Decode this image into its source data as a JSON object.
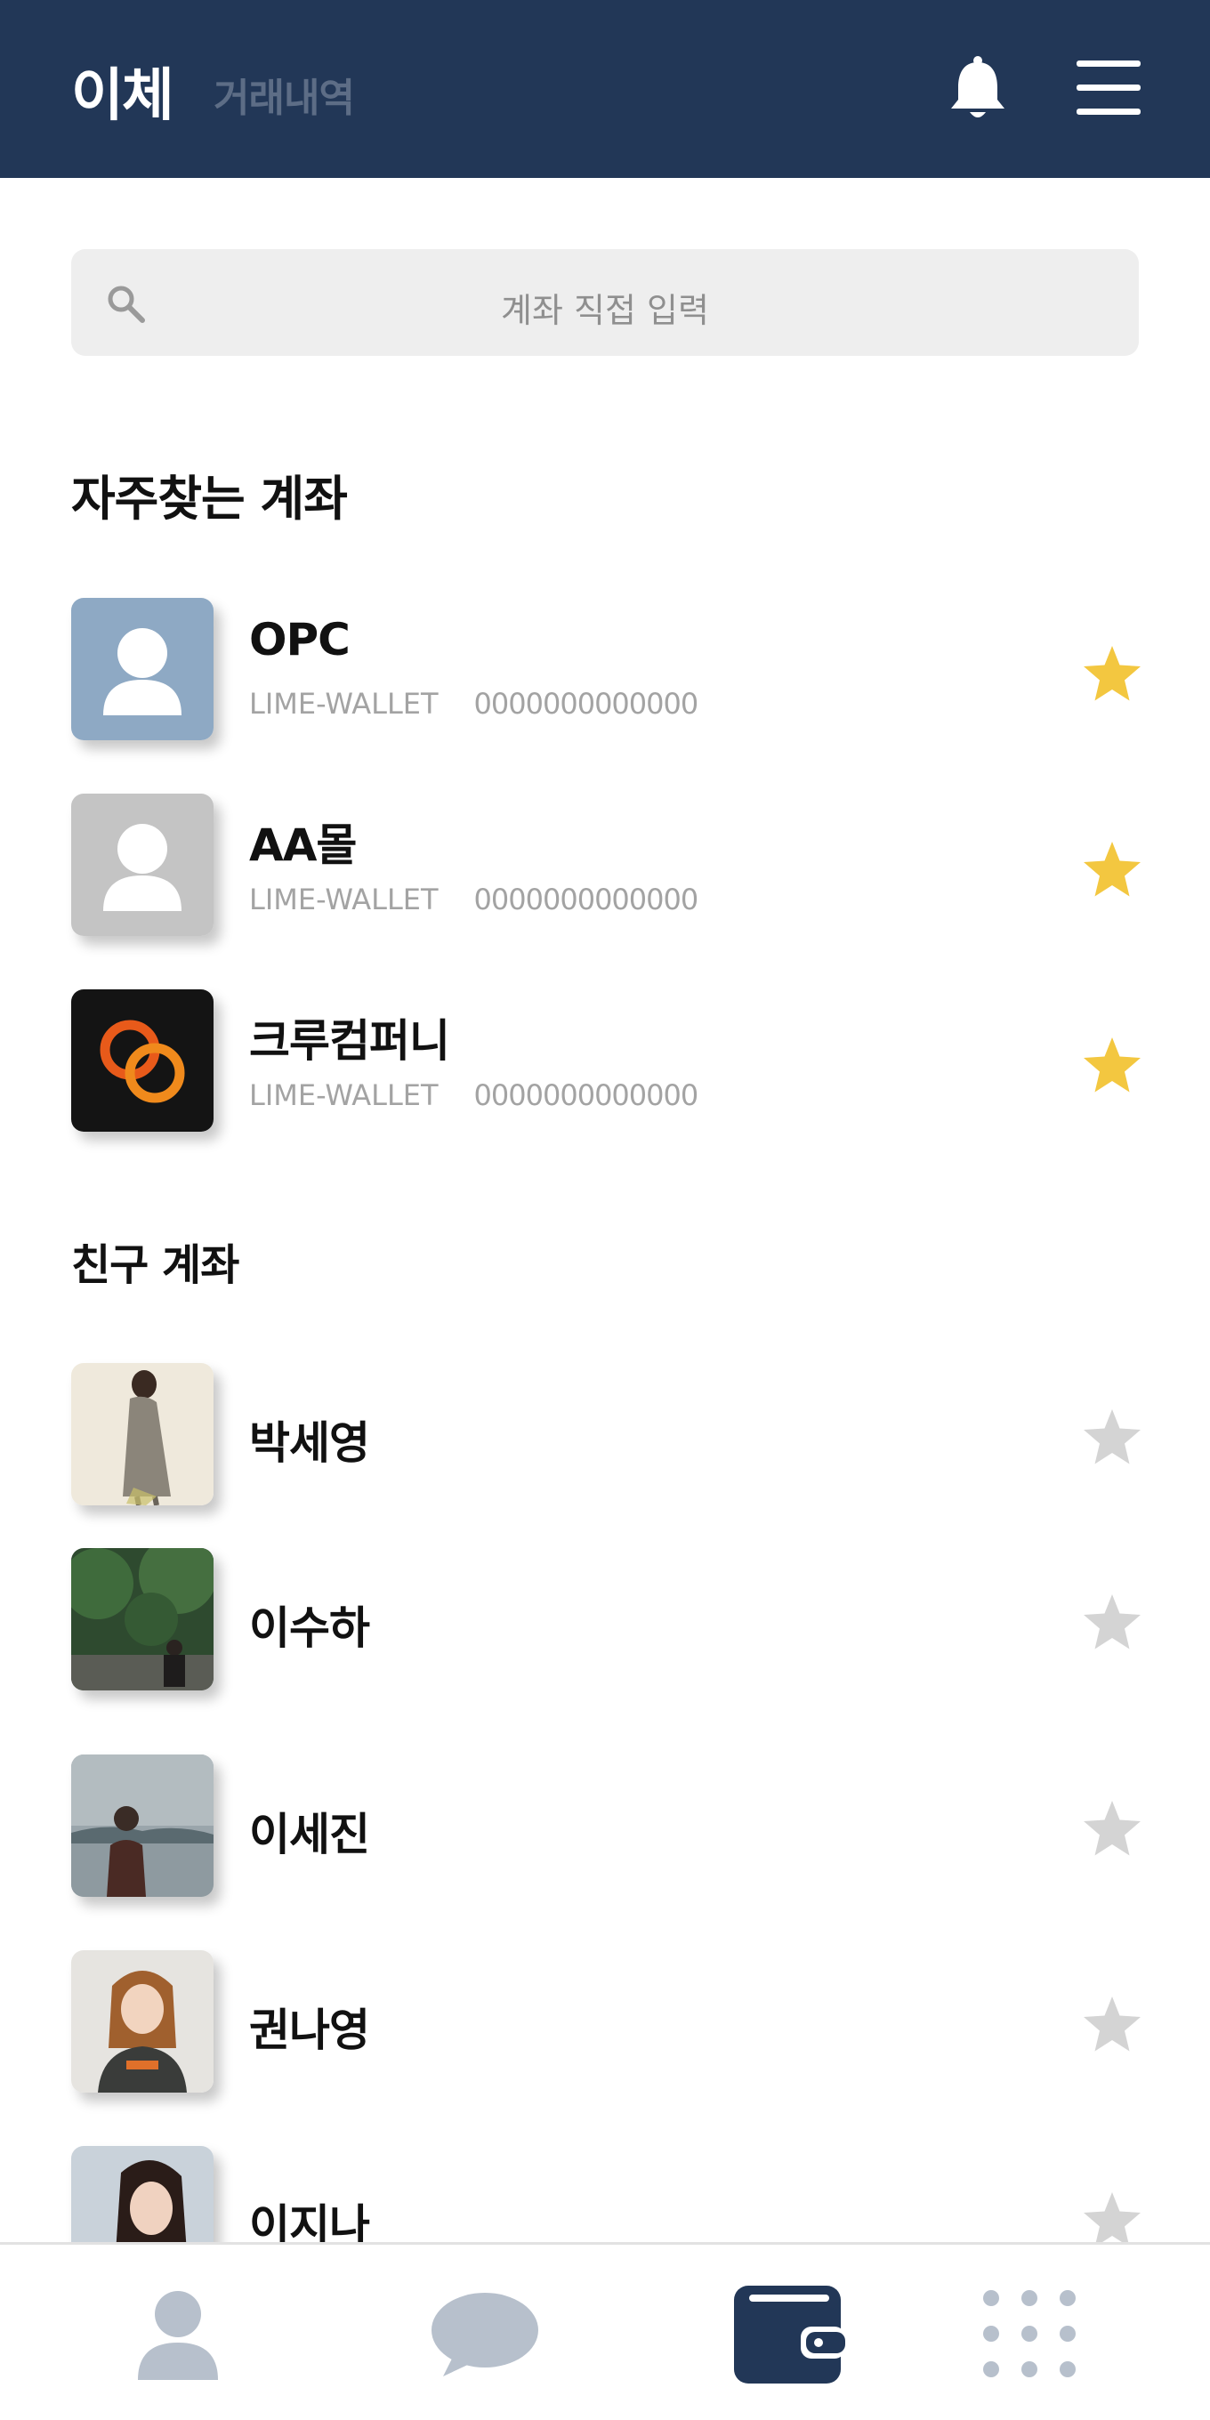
{
  "header": {
    "active_tab": "이체",
    "inactive_tab": "거래내역",
    "icons": [
      "bell-icon",
      "menu-icon"
    ],
    "background": "#223757"
  },
  "search": {
    "placeholder": "계좌 직접 입력",
    "icon": "search-icon"
  },
  "favorites": {
    "title": "자주찾는 계좌",
    "items": [
      {
        "name": "OPC",
        "bank": "LIME-WALLET",
        "account": "0000000000000",
        "starred": true,
        "avatar": "person-icon-blue"
      },
      {
        "name": "AA몰",
        "bank": "LIME-WALLET",
        "account": "0000000000000",
        "starred": true,
        "avatar": "person-icon-gray"
      },
      {
        "name": "크루컴퍼니",
        "bank": "LIME-WALLET",
        "account": "0000000000000",
        "starred": true,
        "avatar": "crew-company-logo"
      }
    ]
  },
  "friends": {
    "title": "친구 계좌",
    "items": [
      {
        "name": "박세영",
        "starred": false
      },
      {
        "name": "이수하",
        "starred": false
      },
      {
        "name": "이세진",
        "starred": false
      },
      {
        "name": "권나영",
        "starred": false
      },
      {
        "name": "이지나",
        "starred": false
      }
    ]
  },
  "bottom_nav": {
    "items": [
      "profile-icon",
      "chat-icon",
      "wallet-icon",
      "apps-grid-icon"
    ],
    "active": "wallet-icon"
  },
  "colors": {
    "accent": "#223757",
    "star_active": "#f3c740",
    "star_inactive": "#d4d4d4",
    "nav_inactive": "#b7c0cc"
  }
}
